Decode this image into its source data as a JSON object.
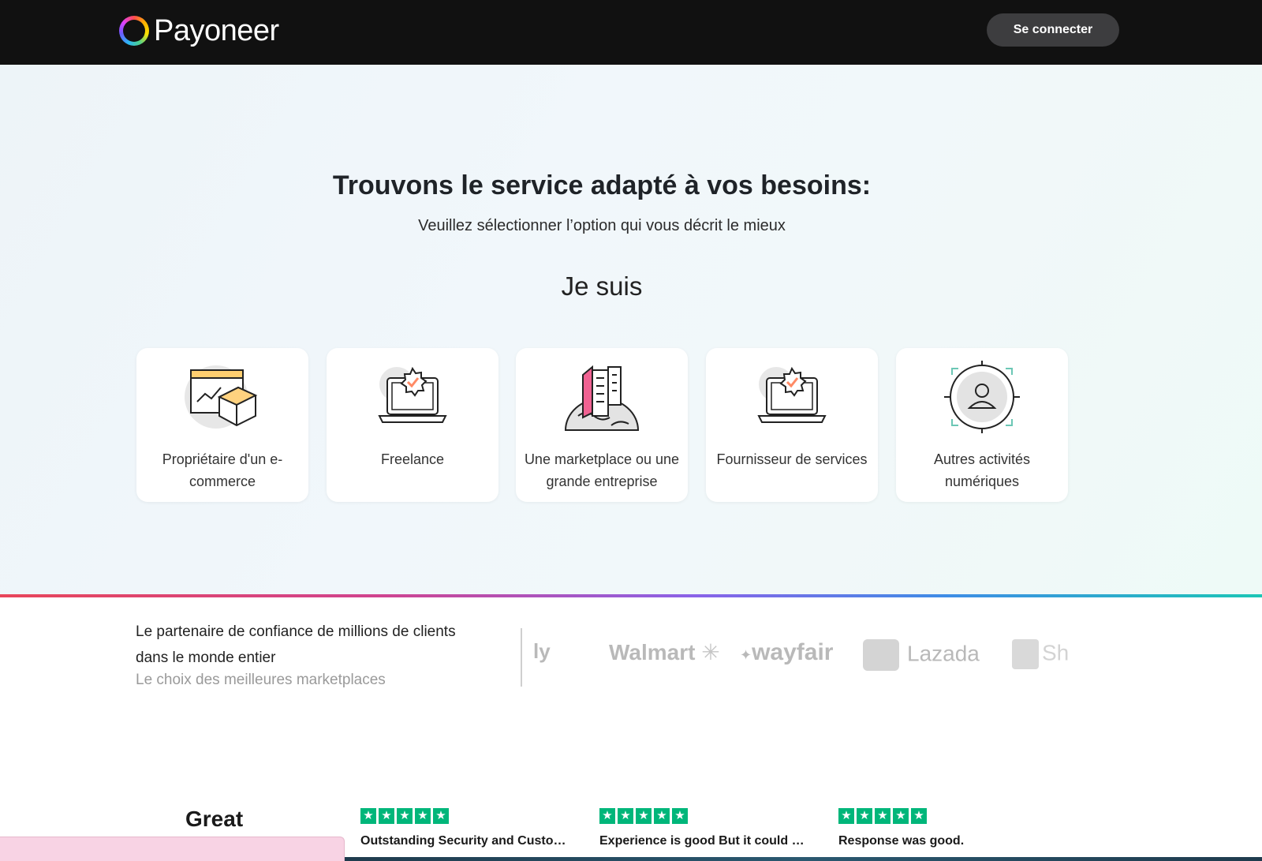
{
  "header": {
    "logo_text": "Payoneer",
    "signin_label": "Se connecter"
  },
  "hero": {
    "title": "Trouvons le service adapté à vos besoins:",
    "subtitle": "Veuillez sélectionner l’option qui vous décrit le mieux",
    "prompt": "Je suis"
  },
  "options": [
    {
      "label": "Propriétaire d'un e-commerce",
      "icon": "ecommerce-box-icon"
    },
    {
      "label": "Freelance",
      "icon": "laptop-badge-icon"
    },
    {
      "label": "Une marketplace ou une grande entreprise",
      "icon": "buildings-globe-icon"
    },
    {
      "label": "Fournisseur de services",
      "icon": "laptop-badge-icon"
    },
    {
      "label": "Autres activités numériques",
      "icon": "user-target-icon"
    }
  ],
  "trust": {
    "title": "Le partenaire de confiance de millions de clients dans le monde entier",
    "subtitle": "Le choix des meilleures marketplaces",
    "brands": [
      "ly",
      "Walmart",
      "wayfair",
      "Lazada",
      "Sho"
    ]
  },
  "reviews": {
    "rating_word": "Great",
    "items": [
      {
        "text": "Outstanding Security and Customer Support",
        "stars": 5
      },
      {
        "text": "Experience is good But it could be better",
        "stars": 5
      },
      {
        "text": "Response was good.",
        "stars": 5
      }
    ]
  },
  "colors": {
    "header_bg": "#111111",
    "trustpilot_green": "#00b67a",
    "accent_pink": "#f06292",
    "accent_orange": "#ff8a65"
  }
}
